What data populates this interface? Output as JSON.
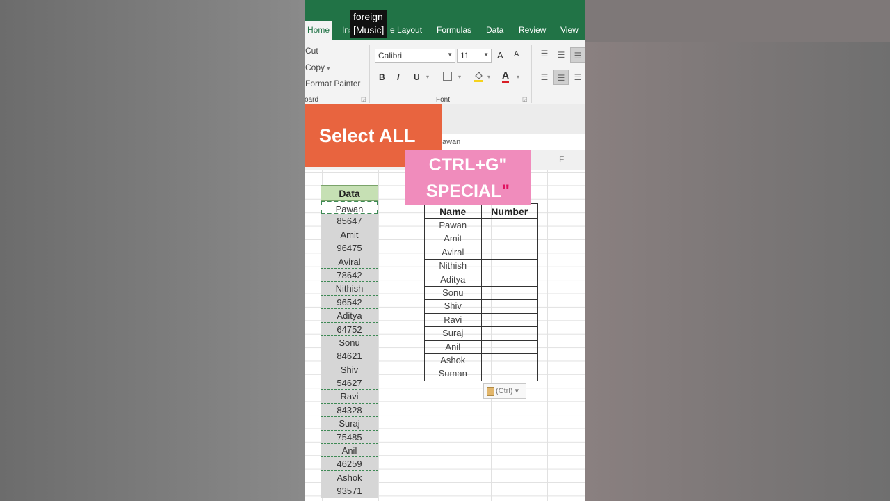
{
  "caption": {
    "line1": "foreign",
    "line2": "[Music]"
  },
  "ribbon": {
    "tabs": [
      {
        "label": "Home",
        "active": true
      },
      {
        "label": "Ins"
      },
      {
        "label": "e Layout"
      },
      {
        "label": "Formulas"
      },
      {
        "label": "Data"
      },
      {
        "label": "Review"
      },
      {
        "label": "View"
      }
    ],
    "clipboard": {
      "cut": "Cut",
      "copy": "Copy",
      "format_painter": "Format Painter",
      "group_label": "oard"
    },
    "font": {
      "name": "Calibri",
      "size": "11",
      "grow": "A",
      "shrink": "A",
      "bold": "B",
      "italic": "I",
      "underline": "U",
      "color_letter": "A",
      "group_label": "Font"
    }
  },
  "formula_bar": {
    "value": "awan"
  },
  "columns": {
    "f": "F"
  },
  "overlay": {
    "select_all": "Select ALL",
    "ctrl_line1": "CTRL+G",
    "ctrl_line2": "SPECIAL",
    "quote": "\""
  },
  "data_column": {
    "header": "Data",
    "values": [
      "Pawan",
      "85647",
      "Amit",
      "96475",
      "Aviral",
      "78642",
      "Nithish",
      "96542",
      "Aditya",
      "64752",
      "Sonu",
      "84621",
      "Shiv",
      "54627",
      "Ravi",
      "84328",
      "Suraj",
      "75485",
      "Anil",
      "46259",
      "Ashok",
      "93571"
    ]
  },
  "result_table": {
    "headers": [
      "Name",
      "Number"
    ],
    "names": [
      "Pawan",
      "Amit",
      "Aviral",
      "Nithish",
      "Aditya",
      "Sonu",
      "Shiv",
      "Ravi",
      "Suraj",
      "Anil",
      "Ashok",
      "Suman"
    ]
  },
  "paste_options": {
    "label": "(Ctrl)",
    "arrow": "▾"
  },
  "colors": {
    "excel_green": "#217346",
    "select_banner": "#e8643f",
    "ctrl_banner": "#f08cbc",
    "data_header": "#c6e0b4"
  }
}
